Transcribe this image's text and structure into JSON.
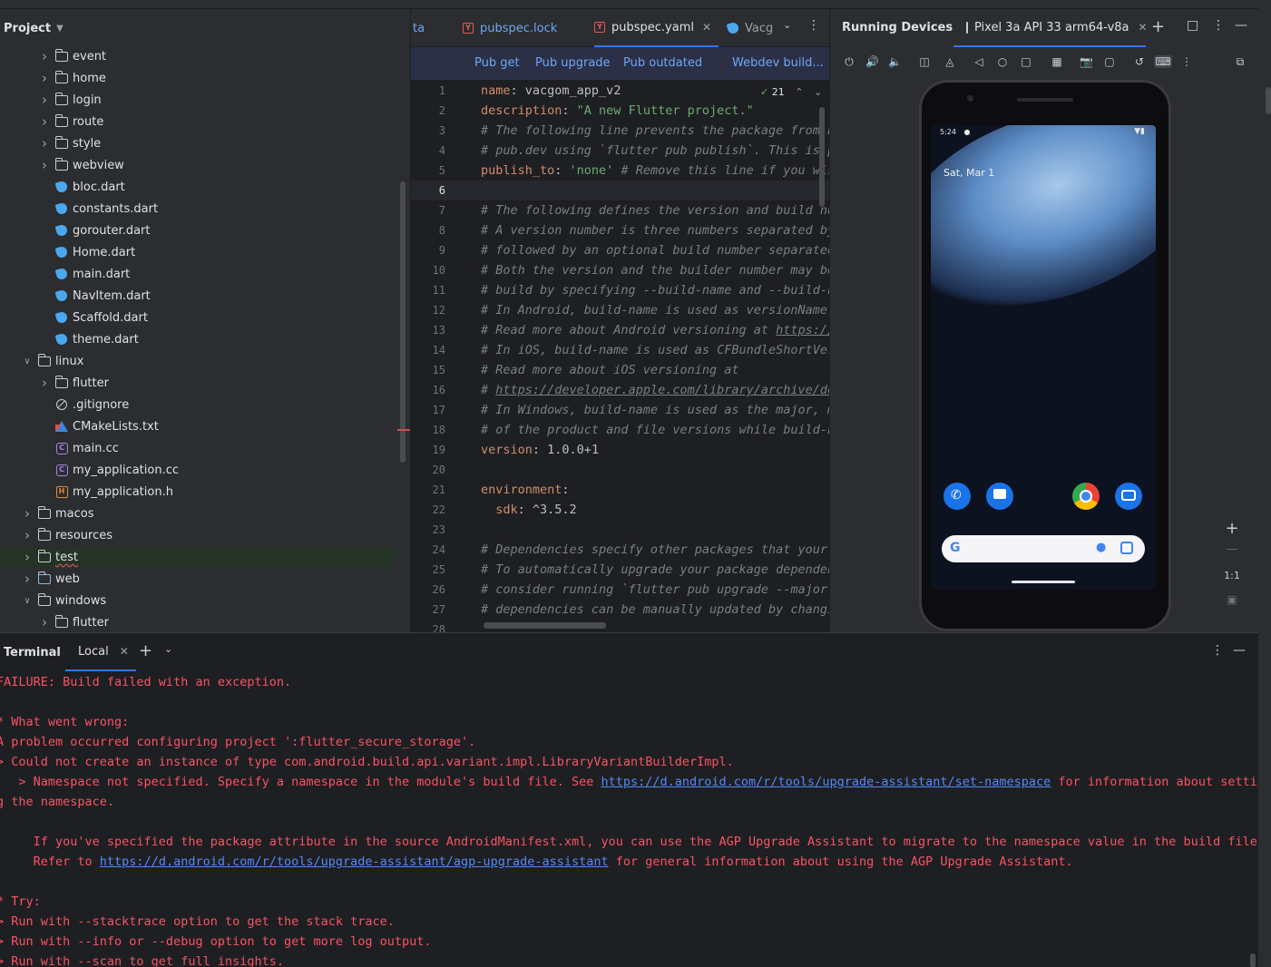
{
  "project": {
    "title": "Project",
    "items": [
      {
        "label": "event",
        "type": "folder",
        "depth": 2,
        "expanded": false
      },
      {
        "label": "home",
        "type": "folder",
        "depth": 2,
        "expanded": false
      },
      {
        "label": "login",
        "type": "folder",
        "depth": 2,
        "expanded": false
      },
      {
        "label": "route",
        "type": "folder",
        "depth": 2,
        "expanded": false
      },
      {
        "label": "style",
        "type": "folder",
        "depth": 2,
        "expanded": false
      },
      {
        "label": "webview",
        "type": "folder",
        "depth": 2,
        "expanded": false
      },
      {
        "label": "bloc.dart",
        "type": "dart",
        "depth": 2
      },
      {
        "label": "constants.dart",
        "type": "dart",
        "depth": 2
      },
      {
        "label": "gorouter.dart",
        "type": "dart",
        "depth": 2
      },
      {
        "label": "Home.dart",
        "type": "dart",
        "depth": 2
      },
      {
        "label": "main.dart",
        "type": "dart",
        "depth": 2
      },
      {
        "label": "NavItem.dart",
        "type": "dart",
        "depth": 2
      },
      {
        "label": "Scaffold.dart",
        "type": "dart",
        "depth": 2
      },
      {
        "label": "theme.dart",
        "type": "dart",
        "depth": 2
      },
      {
        "label": "linux",
        "type": "folder",
        "depth": 1,
        "expanded": true
      },
      {
        "label": "flutter",
        "type": "folder",
        "depth": 2,
        "expanded": false
      },
      {
        "label": ".gitignore",
        "type": "ignore",
        "depth": 2
      },
      {
        "label": "CMakeLists.txt",
        "type": "cmake",
        "depth": 2
      },
      {
        "label": "main.cc",
        "type": "cc",
        "depth": 2
      },
      {
        "label": "my_application.cc",
        "type": "cc",
        "depth": 2
      },
      {
        "label": "my_application.h",
        "type": "h",
        "depth": 2
      },
      {
        "label": "macos",
        "type": "folder",
        "depth": 1,
        "expanded": false
      },
      {
        "label": "resources",
        "type": "folder",
        "depth": 1,
        "expanded": false
      },
      {
        "label": "test",
        "type": "folder",
        "depth": 1,
        "expanded": false,
        "selected": true
      },
      {
        "label": "web",
        "type": "webfolder",
        "depth": 1,
        "expanded": false
      },
      {
        "label": "windows",
        "type": "folder",
        "depth": 1,
        "expanded": true
      },
      {
        "label": "flutter",
        "type": "folder",
        "depth": 2,
        "expanded": false
      }
    ]
  },
  "editor": {
    "tabs": [
      {
        "label": "ta",
        "active": false
      },
      {
        "label": "pubspec.lock",
        "active": false
      },
      {
        "label": "pubspec.yaml",
        "active": true
      },
      {
        "label": "Vacg",
        "active": false
      }
    ],
    "pub_actions": [
      "Pub get",
      "Pub upgrade",
      "Pub outdated",
      "Webdev build..."
    ],
    "inspection_count": "21",
    "current_line": 6,
    "lines": [
      [
        {
          "t": "name",
          "c": "k"
        },
        {
          "t": ": "
        },
        {
          "t": "vacgom_app_v2"
        }
      ],
      [
        {
          "t": "description",
          "c": "k"
        },
        {
          "t": ": "
        },
        {
          "t": "\"A new Flutter project.\"",
          "c": "s"
        }
      ],
      [
        {
          "t": "# The following line prevents the package from be",
          "c": "c"
        }
      ],
      [
        {
          "t": "# pub.dev using `flutter pub publish`. This is pr",
          "c": "c"
        }
      ],
      [
        {
          "t": "publish_to",
          "c": "k"
        },
        {
          "t": ": "
        },
        {
          "t": "'none'",
          "c": "s"
        },
        {
          "t": " # Remove this line if you wish",
          "c": "c"
        }
      ],
      [],
      [
        {
          "t": "# The following defines the version and build num",
          "c": "c"
        }
      ],
      [
        {
          "t": "# A version number is three numbers separated by ",
          "c": "c"
        }
      ],
      [
        {
          "t": "# followed by an optional build number separated ",
          "c": "c"
        }
      ],
      [
        {
          "t": "# Both the version and the builder number may be ",
          "c": "c"
        }
      ],
      [
        {
          "t": "# build by specifying --build-name and --build-nu",
          "c": "c"
        }
      ],
      [
        {
          "t": "# In Android, build-name is used as versionName w",
          "c": "c"
        }
      ],
      [
        {
          "t": "# Read more about Android versioning at ",
          "c": "c"
        },
        {
          "t": "https://de",
          "c": "c u"
        }
      ],
      [
        {
          "t": "# In iOS, build-name is used as CFBundleShortVers",
          "c": "c"
        }
      ],
      [
        {
          "t": "# Read more about iOS versioning at",
          "c": "c"
        }
      ],
      [
        {
          "t": "# ",
          "c": "c"
        },
        {
          "t": "https://developer.apple.com/library/archive/doc",
          "c": "c u"
        }
      ],
      [
        {
          "t": "# In Windows, build-name is used as the major, mi",
          "c": "c"
        }
      ],
      [
        {
          "t": "# of the product and file versions while build-nu",
          "c": "c"
        }
      ],
      [
        {
          "t": "version",
          "c": "k"
        },
        {
          "t": ": "
        },
        {
          "t": "1.0.0+1"
        }
      ],
      [],
      [
        {
          "t": "environment",
          "c": "k"
        },
        {
          "t": ":"
        }
      ],
      [
        {
          "t": "  "
        },
        {
          "t": "sdk",
          "c": "k"
        },
        {
          "t": ": "
        },
        {
          "t": "^3.5.2"
        }
      ],
      [],
      [
        {
          "t": "# Dependencies specify other packages that your p",
          "c": "c"
        }
      ],
      [
        {
          "t": "# To automatically upgrade your package dependenc",
          "c": "c"
        }
      ],
      [
        {
          "t": "# consider running `flutter pub upgrade --major-v",
          "c": "c"
        }
      ],
      [
        {
          "t": "# dependencies can be manually updated by changin",
          "c": "c"
        }
      ],
      []
    ]
  },
  "devices": {
    "title": "Running Devices",
    "device_tab": "Pixel 3a API 33 arm64-v8a",
    "phone": {
      "time": "5:24",
      "date": "Sat, Mar 1"
    },
    "zoom_label": "1:1"
  },
  "terminal": {
    "title": "Terminal",
    "tab": "Local",
    "lines": [
      [
        {
          "t": "FAILURE: Build failed with an exception."
        }
      ],
      [],
      [
        {
          "t": "* What went wrong:"
        }
      ],
      [
        {
          "t": "A problem occurred configuring project ':flutter_secure_storage'."
        }
      ],
      [
        {
          "t": "> Could not create an instance of type com.android.build.api.variant.impl.LibraryVariantBuilderImpl."
        }
      ],
      [
        {
          "t": "   > Namespace not specified. Specify a namespace in the module's build file. See "
        },
        {
          "t": "https://d.android.com/r/tools/upgrade-assistant/set-namespace",
          "link": true
        },
        {
          "t": " for information about settin"
        }
      ],
      [
        {
          "t": "g the namespace."
        }
      ],
      [],
      [
        {
          "t": "     If you've specified the package attribute in the source AndroidManifest.xml, you can use the AGP Upgrade Assistant to migrate to the namespace value in the build file."
        }
      ],
      [
        {
          "t": "     Refer to "
        },
        {
          "t": "https://d.android.com/r/tools/upgrade-assistant/agp-upgrade-assistant",
          "link": true
        },
        {
          "t": " for general information about using the AGP Upgrade Assistant."
        }
      ],
      [],
      [
        {
          "t": "* Try:"
        }
      ],
      [
        {
          "t": "> Run with --stacktrace option to get the stack trace."
        }
      ],
      [
        {
          "t": "> Run with --info or --debug option to get more log output."
        }
      ],
      [
        {
          "t": "> Run with --scan to get full insights."
        }
      ]
    ]
  },
  "colors": {
    "accent": "#3574f0",
    "error_text": "#f75464",
    "link": "#548af7",
    "panel_bg": "#2b2d30",
    "editor_bg": "#1e1f22"
  }
}
